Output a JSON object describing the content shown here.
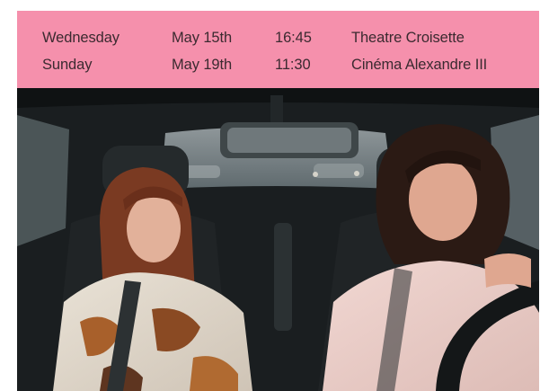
{
  "schedule": {
    "rows": [
      {
        "day": "Wednesday",
        "date": "May 15th",
        "time": "16:45",
        "venue": "Theatre Croisette"
      },
      {
        "day": "Sunday",
        "date": "May 19th",
        "time": "11:30",
        "venue": "Cinéma Alexandre III"
      }
    ]
  },
  "colors": {
    "schedule_background": "#f590ac",
    "schedule_text": "#3b2a30"
  },
  "film_still": {
    "subject": "two women sitting in the front seats of a car"
  }
}
